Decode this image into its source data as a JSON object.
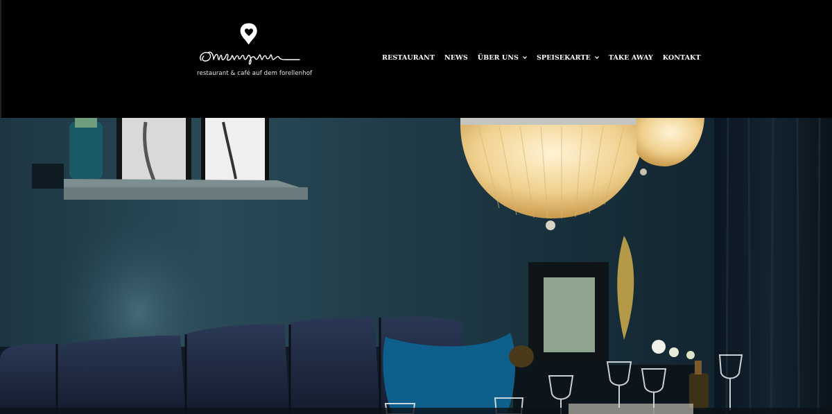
{
  "site": {
    "logo_alt": "Lieblingsplatz",
    "tagline": "restaurant & café auf dem forellenhof"
  },
  "nav": {
    "items": [
      {
        "label": "RESTAURANT",
        "has_dropdown": false
      },
      {
        "label": "NEWS",
        "has_dropdown": false
      },
      {
        "label": "ÜBER UNS",
        "has_dropdown": true
      },
      {
        "label": "SPEISEKARTE",
        "has_dropdown": true
      },
      {
        "label": "TAKE AWAY",
        "has_dropdown": false
      },
      {
        "label": "KONTAKT",
        "has_dropdown": false
      }
    ]
  },
  "colors": {
    "header_bg": "#000000",
    "nav_text": "#ffffff",
    "wall": "#1f3a47",
    "bench": "#1e2a40",
    "cushion": "#0e5a85",
    "lamp": "#f3d9a0"
  },
  "icons": {
    "logo_pin": "heart-pin-icon",
    "dropdown": "chevron-down-icon"
  }
}
